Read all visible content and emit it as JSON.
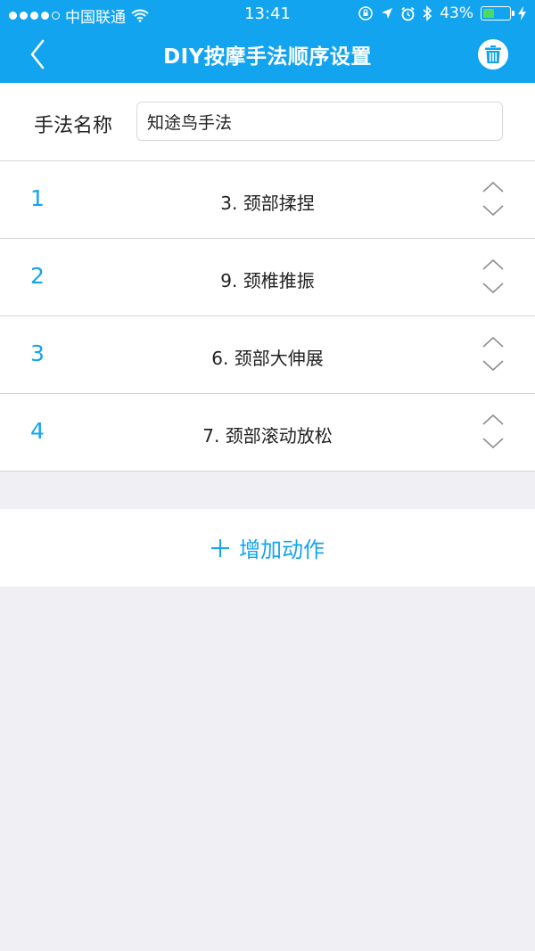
{
  "status_bar": {
    "carrier": "中国联通",
    "time": "13:41",
    "battery": "43%",
    "battery_level": 0.43
  },
  "nav": {
    "title": "DIY按摩手法顺序设置",
    "back_icon": "chevron-left-icon",
    "delete_icon": "trash-icon"
  },
  "form": {
    "name_label": "手法名称",
    "name_value": "知途鸟手法"
  },
  "sequence": [
    {
      "index": "1",
      "name": "3. 颈部揉捏"
    },
    {
      "index": "2",
      "name": "9. 颈椎推振"
    },
    {
      "index": "3",
      "name": "6. 颈部大伸展"
    },
    {
      "index": "4",
      "name": "7. 颈部滚动放松"
    }
  ],
  "add_action": {
    "label": "增加动作",
    "icon": "plus-icon"
  },
  "colors": {
    "accent": "#13a4f0",
    "background": "#efeff4",
    "battery_fill": "#4cd964"
  }
}
